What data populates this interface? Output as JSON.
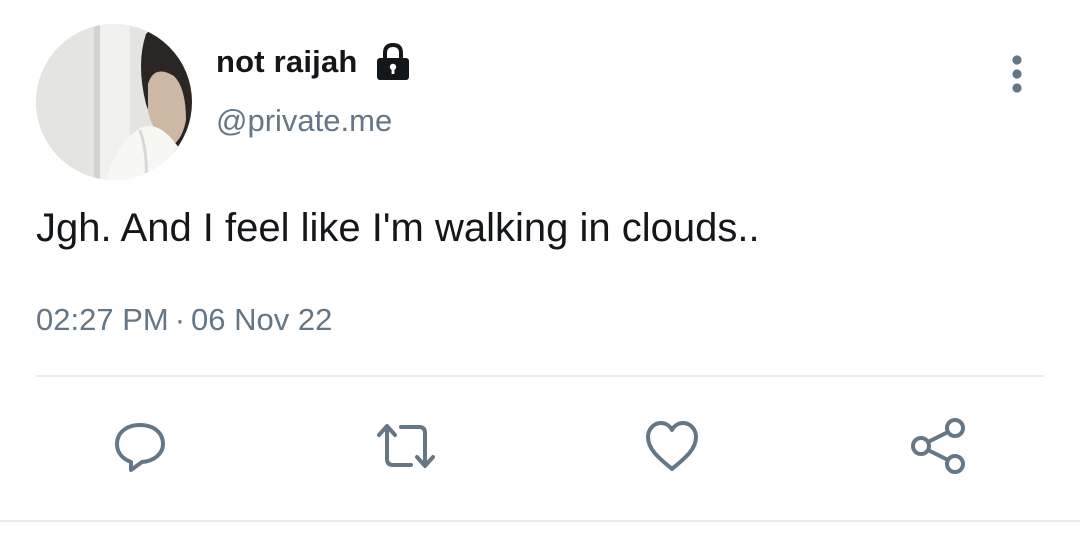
{
  "author": {
    "display_name": "not raijah",
    "handle": "@private.me",
    "protected_icon": "lock-icon",
    "avatar": "profile-photo"
  },
  "menu": {
    "icon": "more-vertical-icon"
  },
  "tweet": {
    "text": "Jgh. And I feel like I'm walking in clouds..",
    "time": "02:27 PM",
    "separator": "·",
    "date": "06 Nov 22"
  },
  "actions": [
    {
      "icon": "reply-icon"
    },
    {
      "icon": "retweet-icon"
    },
    {
      "icon": "like-icon"
    },
    {
      "icon": "share-icon"
    }
  ],
  "colors": {
    "text": "#14171a",
    "secondary": "#657786",
    "divider": "#e6ecf0",
    "icon": "#657786"
  }
}
